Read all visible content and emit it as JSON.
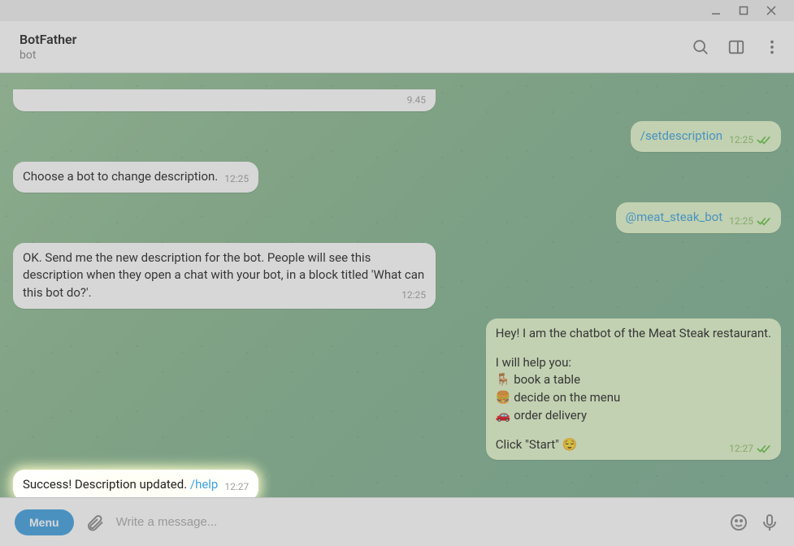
{
  "window": {
    "minimize": "–",
    "maximize": "☐",
    "close": "✕"
  },
  "header": {
    "title": "BotFather",
    "subtitle": "bot"
  },
  "messages": {
    "partial_time": "9.45",
    "m1_cmd": "/setdescription",
    "m1_time": "12:25",
    "m2_text": "Choose a bot to change description.",
    "m2_time": "12:25",
    "m3_mention": "@meat_steak_bot",
    "m3_time": "12:25",
    "m4_text": "OK. Send me the new description for the bot. People will see this description when they open a chat with your bot, in a block titled 'What can this bot do?'.",
    "m4_time": "12:25",
    "m5_line1": "Hey! I am the chatbot of the Meat Steak restaurant.",
    "m5_line2": "I will help you:",
    "m5_line3": "🪑 book a table",
    "m5_line4": "🍔 decide on the menu",
    "m5_line5": "🚗 order delivery",
    "m5_line6": "Click \"Start\" 😌",
    "m5_time": "12:27",
    "m6_text": "Success! Description updated. ",
    "m6_link": "/help",
    "m6_time": "12:27"
  },
  "input": {
    "menu": "Menu",
    "placeholder": "Write a message..."
  }
}
